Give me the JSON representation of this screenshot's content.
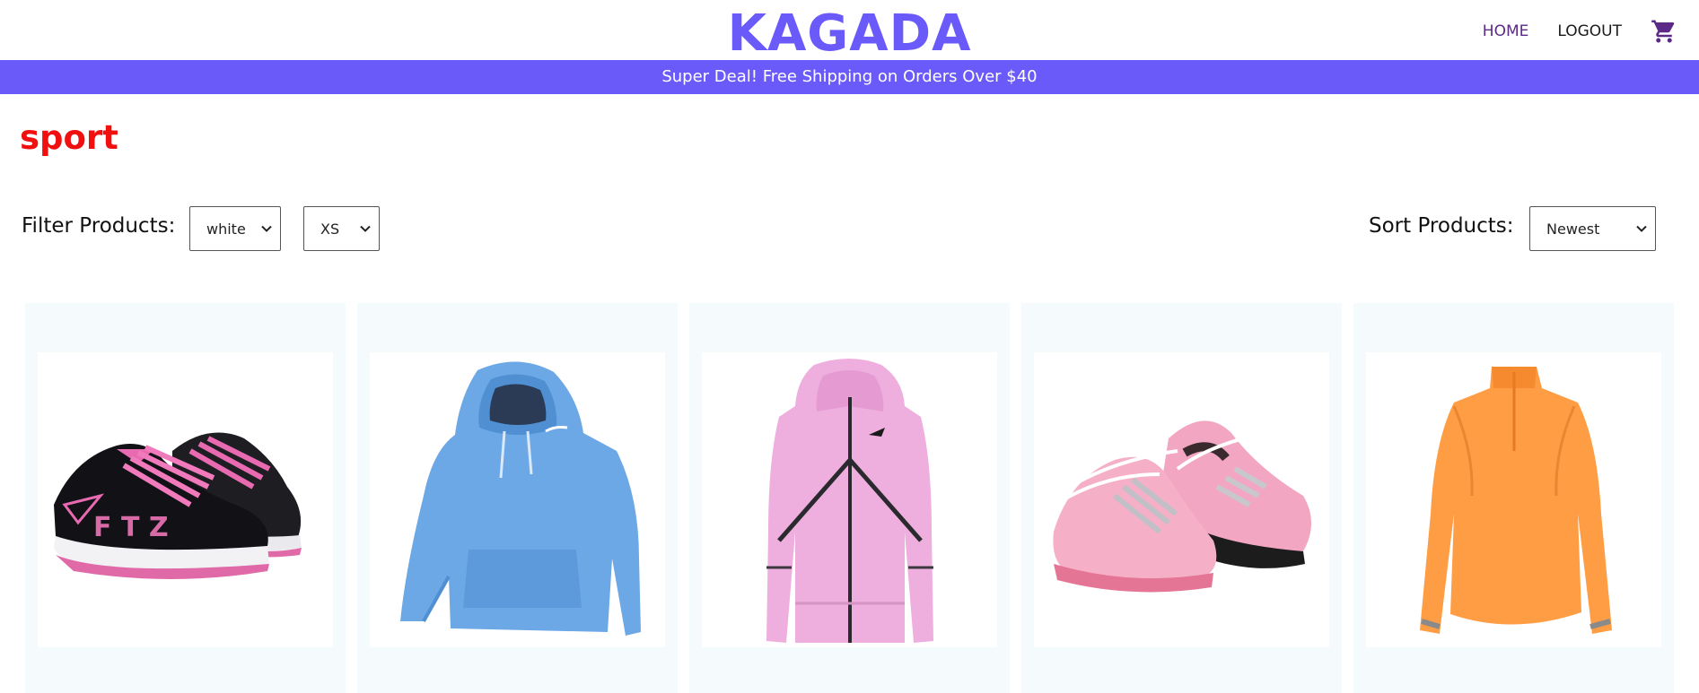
{
  "header": {
    "logo": "KAGADA",
    "nav": {
      "home": "HOME",
      "logout": "LOGOUT"
    },
    "cart_icon": "shopping-cart-icon"
  },
  "announcement": {
    "text": "Super Deal! Free Shipping on Orders Over $40"
  },
  "category": {
    "title": "sport"
  },
  "filters": {
    "label": "Filter Products:",
    "color_value": "white",
    "size_value": "XS"
  },
  "sort": {
    "label": "Sort Products:",
    "value": "Newest"
  },
  "products": [
    {
      "image": "black-pink-running-sneakers"
    },
    {
      "image": "light-blue-nike-hoodie"
    },
    {
      "image": "pink-nike-zip-jacket"
    },
    {
      "image": "pink-white-bowling-shoes"
    },
    {
      "image": "orange-half-zip-top"
    }
  ],
  "colors": {
    "brand": "#6a5af9",
    "category": "#f01010",
    "card_bg": "#f5fbfd"
  }
}
